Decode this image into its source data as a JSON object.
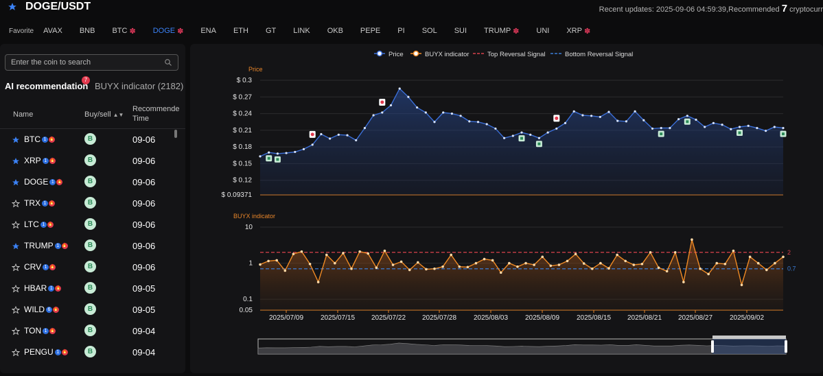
{
  "header": {
    "pair": "DOGE/USDT",
    "recent_prefix": "Recent updates: 2025-09-06 04:59:39,Recommended ",
    "recent_count": "7",
    "recent_suffix": " cryptocurr"
  },
  "favorites": {
    "label": "Favorite",
    "coins": [
      {
        "label": "AVAX",
        "gear": false,
        "active": false
      },
      {
        "label": "BNB",
        "gear": false,
        "active": false
      },
      {
        "label": "BTC",
        "gear": true,
        "active": false
      },
      {
        "label": "DOGE",
        "gear": true,
        "active": true
      },
      {
        "label": "ENA",
        "gear": false,
        "active": false
      },
      {
        "label": "ETH",
        "gear": false,
        "active": false
      },
      {
        "label": "GT",
        "gear": false,
        "active": false
      },
      {
        "label": "LINK",
        "gear": false,
        "active": false
      },
      {
        "label": "OKB",
        "gear": false,
        "active": false
      },
      {
        "label": "PEPE",
        "gear": false,
        "active": false
      },
      {
        "label": "PI",
        "gear": false,
        "active": false
      },
      {
        "label": "SOL",
        "gear": false,
        "active": false
      },
      {
        "label": "SUI",
        "gear": false,
        "active": false
      },
      {
        "label": "TRUMP",
        "gear": true,
        "active": false
      },
      {
        "label": "UNI",
        "gear": false,
        "active": false
      },
      {
        "label": "XRP",
        "gear": true,
        "active": false
      }
    ]
  },
  "search": {
    "placeholder": "Enter the coin to search"
  },
  "tabs": {
    "ai": "AI recommendation",
    "ai_badge": "7",
    "buyx": "BUYX indicator (2182)"
  },
  "table": {
    "col_name": "Name",
    "col_buysell": "Buy/sell",
    "col_time_1": "Recommende",
    "col_time_2": "Time",
    "rows": [
      {
        "symbol": "BTC",
        "starred": true,
        "b1": "1",
        "signal": "B",
        "date": "09-06"
      },
      {
        "symbol": "XRP",
        "starred": true,
        "b1": "1",
        "signal": "B",
        "date": "09-06"
      },
      {
        "symbol": "DOGE",
        "starred": true,
        "b1": "1",
        "signal": "B",
        "date": "09-06"
      },
      {
        "symbol": "TRX",
        "starred": false,
        "b1": "1",
        "signal": "B",
        "date": "09-06"
      },
      {
        "symbol": "LTC",
        "starred": false,
        "b1": "1",
        "signal": "B",
        "date": "09-06"
      },
      {
        "symbol": "TRUMP",
        "starred": true,
        "b1": "1",
        "signal": "B",
        "date": "09-06"
      },
      {
        "symbol": "CRV",
        "starred": false,
        "b1": "1",
        "signal": "B",
        "date": "09-06"
      },
      {
        "symbol": "HBAR",
        "starred": false,
        "b1": "1",
        "signal": "B",
        "date": "09-05"
      },
      {
        "symbol": "WILD",
        "starred": false,
        "b1": "6",
        "signal": "B",
        "date": "09-05"
      },
      {
        "symbol": "TON",
        "starred": false,
        "b1": "1",
        "signal": "B",
        "date": "09-04"
      },
      {
        "symbol": "PENGU",
        "starred": false,
        "b1": "1",
        "signal": "B",
        "date": "09-04"
      }
    ]
  },
  "colors": {
    "accent": "#3b82f6",
    "price_line": "#3b6fd8",
    "buyx_line": "#f08a24",
    "top_signal": "#d8414c",
    "bottom_signal": "#3a7bd5",
    "buy_badge_bg": "#c8ebd6",
    "sell_marker": "#e23a4e"
  },
  "chart_data": [
    {
      "type": "line",
      "title": "Price",
      "ylabel": "Price",
      "legend": [
        "Price",
        "BUYX indicator",
        "Top Reversal Signal",
        "Bottom Reversal Signal"
      ],
      "legend_placement": "top-center",
      "y_ticks": [
        "$ 0.3",
        "$ 0.27",
        "$ 0.24",
        "$ 0.21",
        "$ 0.18",
        "$ 0.15",
        "$ 0.12",
        "$ 0.09371"
      ],
      "ylim": [
        0.09371,
        0.3
      ],
      "x_ticks": [
        "2025/07/09",
        "2025/07/15",
        "2025/07/22",
        "2025/07/28",
        "2025/08/03",
        "2025/08/09",
        "2025/08/15",
        "2025/08/21",
        "2025/08/27",
        "2025/09/02"
      ],
      "series": [
        {
          "name": "Price",
          "values": [
            0.163,
            0.17,
            0.168,
            0.169,
            0.171,
            0.176,
            0.184,
            0.203,
            0.195,
            0.202,
            0.201,
            0.192,
            0.214,
            0.237,
            0.242,
            0.255,
            0.285,
            0.27,
            0.251,
            0.242,
            0.225,
            0.242,
            0.24,
            0.236,
            0.226,
            0.225,
            0.221,
            0.213,
            0.196,
            0.2,
            0.206,
            0.202,
            0.196,
            0.206,
            0.213,
            0.223,
            0.244,
            0.237,
            0.236,
            0.234,
            0.243,
            0.227,
            0.226,
            0.244,
            0.228,
            0.213,
            0.214,
            0.214,
            0.23,
            0.236,
            0.229,
            0.216,
            0.223,
            0.22,
            0.212,
            0.216,
            0.218,
            0.214,
            0.209,
            0.216,
            0.214
          ]
        }
      ],
      "sell_markers": [
        6,
        14,
        34
      ],
      "buy_markers": [
        1,
        2,
        30,
        32,
        46,
        49,
        55,
        60
      ]
    },
    {
      "type": "line",
      "title": "BUYX indicator",
      "ylabel": "BUYX indicator",
      "yscale": "log",
      "y_ticks": [
        "10",
        "1",
        "0.1",
        "0.05"
      ],
      "ylim": [
        0.05,
        10
      ],
      "reference_lines": [
        {
          "label": "2",
          "value": 2,
          "name": "Top Reversal Signal"
        },
        {
          "label": "0.7",
          "value": 0.7,
          "name": "Bottom Reversal Signal"
        }
      ],
      "series": [
        {
          "name": "BUYX indicator",
          "values": [
            0.92,
            1.15,
            1.2,
            0.62,
            1.8,
            2.1,
            0.95,
            0.3,
            1.7,
            1.0,
            1.9,
            0.7,
            2.1,
            1.85,
            0.75,
            2.2,
            0.9,
            1.1,
            0.65,
            1.05,
            0.68,
            0.7,
            0.8,
            1.7,
            0.8,
            0.78,
            1.0,
            1.3,
            1.2,
            0.55,
            1.0,
            0.8,
            1.0,
            0.9,
            1.5,
            0.85,
            0.9,
            1.15,
            1.8,
            0.98,
            0.7,
            1.0,
            0.72,
            1.7,
            1.15,
            0.9,
            0.95,
            2.0,
            0.75,
            0.6,
            2.0,
            0.3,
            4.5,
            0.7,
            0.5,
            1.0,
            0.95,
            2.2,
            0.25,
            1.5,
            1.0,
            0.65,
            1.0,
            1.5
          ]
        }
      ]
    }
  ]
}
